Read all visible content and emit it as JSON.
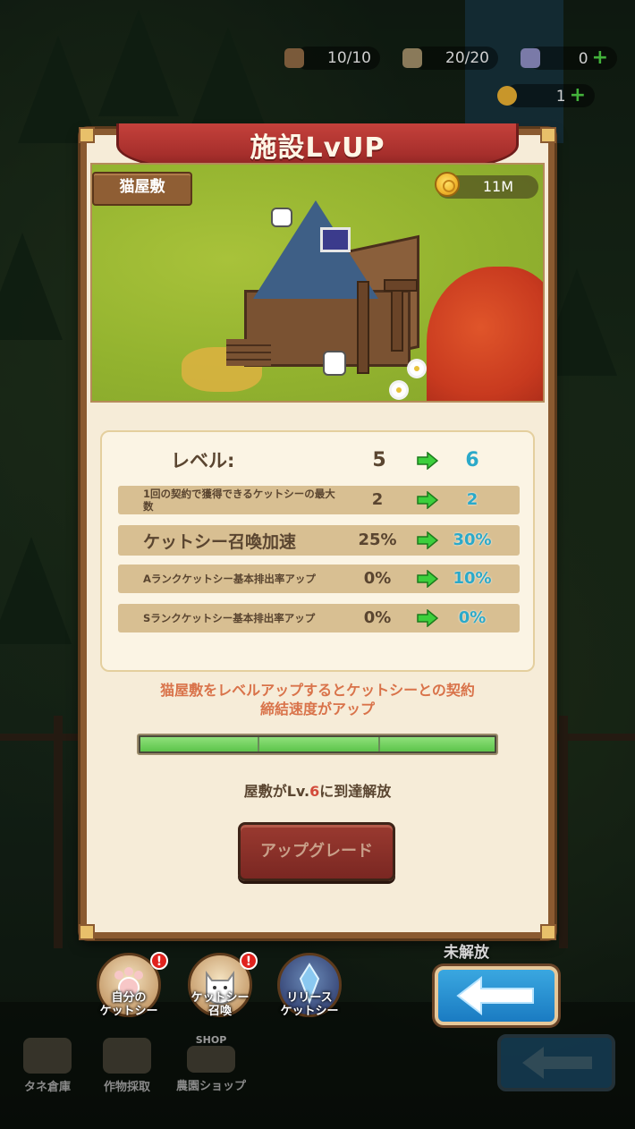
{
  "resources": {
    "wood": "10/10",
    "seed": "20/20",
    "gem": "0",
    "leaf": "1"
  },
  "modal": {
    "title": "施設LvUP",
    "facility_name": "猫屋敷",
    "coin_amount": "11M",
    "level_label": "レベル:",
    "level_current": "5",
    "level_next": "6",
    "stats": [
      {
        "label": "1回の契約で獲得できるケットシーの最大数",
        "current": "2",
        "next": "2"
      },
      {
        "label": "ケットシー召喚加速",
        "current": "25%",
        "next": "30%"
      },
      {
        "label": "Aランクケットシー基本排出率アップ",
        "current": "0%",
        "next": "10%"
      },
      {
        "label": "Sランクケットシー基本排出率アップ",
        "current": "0%",
        "next": "0%"
      }
    ],
    "description_line1": "猫屋敷をレベルアップするとケットシーとの契約",
    "description_line2": "締結速度がアップ",
    "progress": 1.0,
    "requirement_prefix": "屋敷がLv.",
    "requirement_level": "6",
    "requirement_suffix": "に到達解放",
    "upgrade_label": "アップグレード"
  },
  "bottom_buttons": [
    {
      "label": "自分の\nケットシー",
      "badge": "!"
    },
    {
      "label": "ケットシー\n召喚",
      "badge": "!"
    },
    {
      "label": "リリース\nケットシー",
      "badge": ""
    }
  ],
  "locked_label": "未解放",
  "footer": [
    {
      "label": "タネ倉庫"
    },
    {
      "label": "作物採取"
    },
    {
      "label": "農園ショップ",
      "sub": "SHOP"
    }
  ],
  "colors": {
    "ribbon": "#b3332f",
    "panel_bg": "#f6ecd8",
    "stat_row_bg": "#d8bf92",
    "next_value": "#2ba9c9",
    "arrow": "#3ccf3c",
    "progress_fill": "#6fd35a",
    "upgrade_btn": "#8a2f28",
    "back_btn": "#2a95d8"
  }
}
